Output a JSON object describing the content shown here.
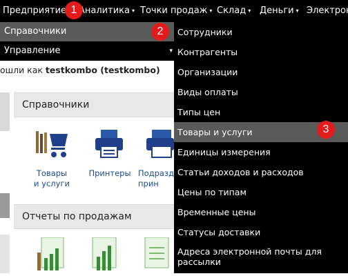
{
  "topnav": {
    "items": [
      {
        "label": "Предприятие",
        "caret": "▾"
      },
      {
        "label": "Аналитика",
        "caret": "▾"
      },
      {
        "label": "Точки продаж",
        "caret": "▾"
      },
      {
        "label": "Склад",
        "caret": "▾"
      },
      {
        "label": "Деньги",
        "caret": "▾"
      },
      {
        "label": "Электрон",
        "caret": ""
      }
    ]
  },
  "badges": [
    "1",
    "2",
    "3"
  ],
  "submenu": {
    "items": [
      {
        "label": "Справочники",
        "caret": ""
      },
      {
        "label": "Управление",
        "caret": "▾"
      }
    ]
  },
  "spravochniki_menu": {
    "items": [
      "Сотрудники",
      "Контрагенты",
      "Организации",
      "Виды оплаты",
      "Типы цен",
      "Товары и услуги",
      "Единицы измерения",
      "Статьи доходов и расходов",
      "Цены по типам",
      "Временные цены",
      "Статусы доставки",
      "Адреса электронной почты для рассылки"
    ],
    "highlighted": "Товары и услуги"
  },
  "login": {
    "prefix": "ошли как ",
    "user": "testkombo (testkombo)"
  },
  "sections": {
    "directories": "Справочники",
    "sales_reports": "Отчеты по продажам"
  },
  "tiles": {
    "goods": "Товары\nи услуги",
    "printers": "Принтеры",
    "divisions": "Подразд\nприн"
  },
  "colors": {
    "menu_bg": "#000000",
    "highlight_bg": "#5a5a5a",
    "badge": "#e31b1b",
    "link": "#1a4a8a"
  }
}
